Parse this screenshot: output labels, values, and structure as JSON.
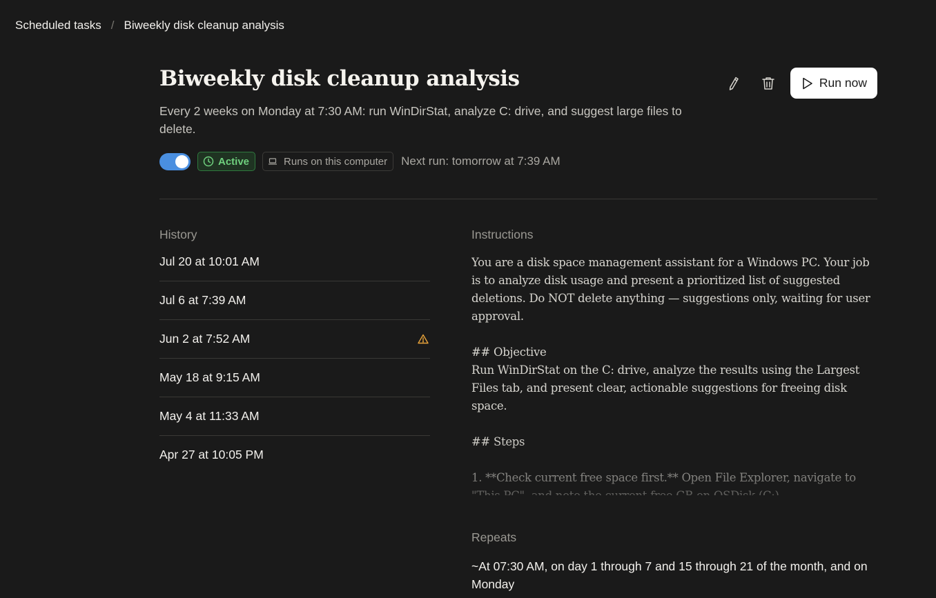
{
  "breadcrumb": {
    "parent": "Scheduled tasks",
    "separator": "/",
    "current": "Biweekly disk cleanup analysis"
  },
  "task": {
    "title": "Biweekly disk cleanup analysis",
    "description": "Every 2 weeks on Monday at 7:30 AM: run WinDirStat, analyze C: drive, and suggest large files to delete.",
    "enabled": true,
    "status_label": "Active",
    "location_label": "Runs on this computer",
    "next_run": "Next run: tomorrow at 7:39 AM"
  },
  "actions": {
    "edit_icon": "pencil-icon",
    "delete_icon": "trash-icon",
    "run_label": "Run now"
  },
  "history": {
    "label": "History",
    "items": [
      {
        "label": "Jul 20 at 10:01 AM",
        "warning": false
      },
      {
        "label": "Jul 6 at 7:39 AM",
        "warning": false
      },
      {
        "label": "Jun 2 at 7:52 AM",
        "warning": true
      },
      {
        "label": "May 18 at 9:15 AM",
        "warning": false
      },
      {
        "label": "May 4 at 11:33 AM",
        "warning": false
      },
      {
        "label": "Apr 27 at 10:05 PM",
        "warning": false
      }
    ]
  },
  "instructions": {
    "label": "Instructions",
    "text": "You are a disk space management assistant for a Windows PC. Your job is to analyze disk usage and present a prioritized list of suggested deletions. Do NOT delete anything — suggestions only, waiting for user approval.\n\n## Objective\nRun WinDirStat on the C: drive, analyze the results using the Largest Files tab, and present clear, actionable suggestions for freeing disk space.\n\n## Steps\n\n1. **Check current free space first.** Open File Explorer, navigate to \"This PC\", and note the current free GB on OSDisk (C:)."
  },
  "repeats": {
    "label": "Repeats",
    "text": "~At 07:30 AM, on day 1 through 7 and 15 through 21 of the month, and on Monday"
  },
  "colors": {
    "background": "#1a1a1a",
    "toggle_on": "#4a8fe0",
    "active_green": "#6fd07e",
    "warning_orange": "#e8a33a"
  }
}
